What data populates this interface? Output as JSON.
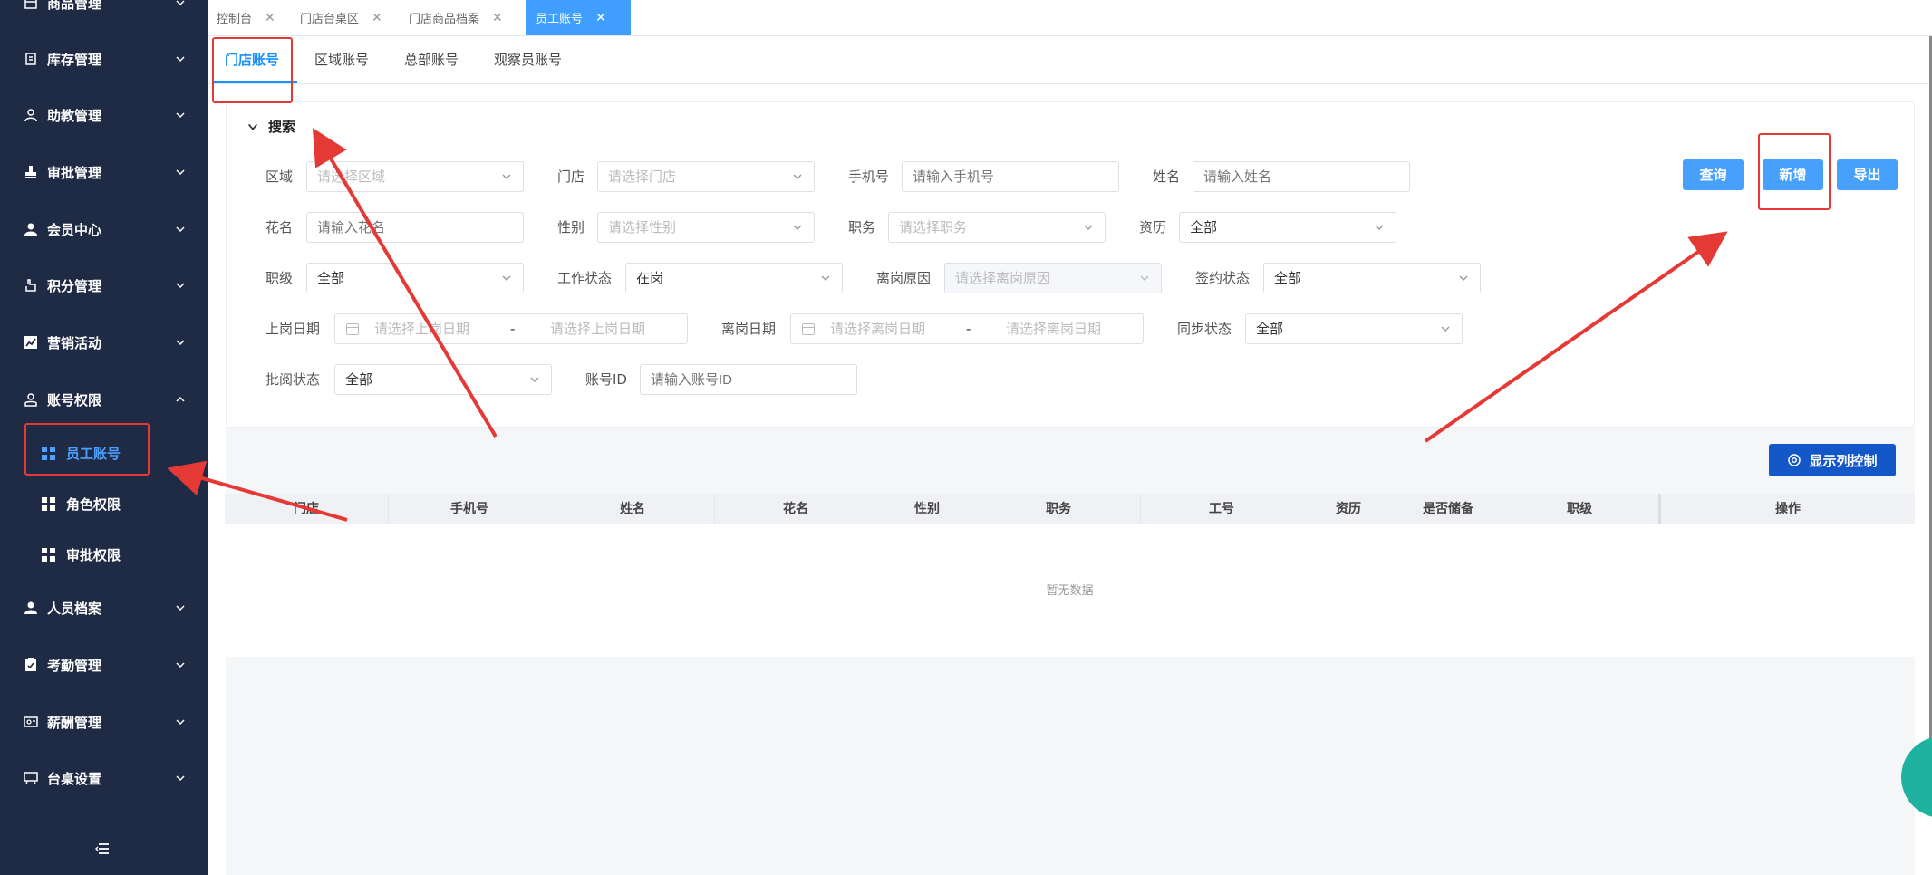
{
  "sidebar": {
    "items": [
      {
        "label": "商品管理",
        "icon": "goods-icon",
        "expanded": false
      },
      {
        "label": "库存管理",
        "icon": "inventory-icon",
        "expanded": false
      },
      {
        "label": "助教管理",
        "icon": "user-icon",
        "expanded": false
      },
      {
        "label": "审批管理",
        "icon": "stamp-icon",
        "expanded": false
      },
      {
        "label": "会员中心",
        "icon": "member-icon",
        "expanded": false
      },
      {
        "label": "积分管理",
        "icon": "points-icon",
        "expanded": false
      },
      {
        "label": "营销活动",
        "icon": "chart-icon",
        "expanded": false
      },
      {
        "label": "账号权限",
        "icon": "account-icon",
        "expanded": true
      },
      {
        "label": "人员档案",
        "icon": "person-icon",
        "expanded": false
      },
      {
        "label": "考勤管理",
        "icon": "clipboard-icon",
        "expanded": false
      },
      {
        "label": "薪酬管理",
        "icon": "salary-icon",
        "expanded": false
      },
      {
        "label": "台桌设置",
        "icon": "table-icon",
        "expanded": false
      }
    ],
    "subitems": [
      {
        "label": "员工账号",
        "active": true
      },
      {
        "label": "角色权限",
        "active": false
      },
      {
        "label": "审批权限",
        "active": false
      }
    ],
    "collapse_icon": "menu-collapse-icon"
  },
  "page_tabs": [
    {
      "label": "控制台",
      "active": false
    },
    {
      "label": "门店台桌区",
      "active": false
    },
    {
      "label": "门店商品档案",
      "active": false
    },
    {
      "label": "员工账号",
      "active": true
    }
  ],
  "sub_tabs": [
    {
      "label": "门店账号",
      "active": true
    },
    {
      "label": "区域账号",
      "active": false
    },
    {
      "label": "总部账号",
      "active": false
    },
    {
      "label": "观察员账号",
      "active": false
    }
  ],
  "search": {
    "title": "搜索",
    "fields": {
      "region": {
        "label": "区域",
        "placeholder": "请选择区域"
      },
      "store": {
        "label": "门店",
        "placeholder": "请选择门店"
      },
      "phone": {
        "label": "手机号",
        "placeholder": "请输入手机号"
      },
      "name": {
        "label": "姓名",
        "placeholder": "请输入姓名"
      },
      "nickname": {
        "label": "花名",
        "placeholder": "请输入花名"
      },
      "gender": {
        "label": "性别",
        "placeholder": "请选择性别"
      },
      "position": {
        "label": "职务",
        "placeholder": "请选择职务"
      },
      "seniority": {
        "label": "资历",
        "value": "全部"
      },
      "rank": {
        "label": "职级",
        "value": "全部"
      },
      "work_status": {
        "label": "工作状态",
        "value": "在岗"
      },
      "leave_reason": {
        "label": "离岗原因",
        "placeholder": "请选择离岗原因"
      },
      "contract_status": {
        "label": "签约状态",
        "value": "全部"
      },
      "onboard_date": {
        "label": "上岗日期",
        "start_placeholder": "请选择上岗日期",
        "end_placeholder": "请选择上岗日期",
        "separator": "-"
      },
      "leave_date": {
        "label": "离岗日期",
        "start_placeholder": "请选择离岗日期",
        "end_placeholder": "请选择离岗日期",
        "separator": "-"
      },
      "sync_status": {
        "label": "同步状态",
        "value": "全部"
      },
      "review_status": {
        "label": "批阅状态",
        "value": "全部"
      },
      "account_id": {
        "label": "账号ID",
        "placeholder": "请输入账号ID"
      }
    },
    "buttons": {
      "query": "查询",
      "add": "新增",
      "export": "导出"
    }
  },
  "table": {
    "column_control_label": "显示列控制",
    "columns": [
      "门店",
      "手机号",
      "姓名",
      "花名",
      "性别",
      "职务",
      "工号",
      "资历",
      "是否储备",
      "职级",
      "操作"
    ],
    "rows": [],
    "empty_text": "暂无数据"
  },
  "colors": {
    "sidebar_bg": "#1f2a44",
    "accent": "#409eff",
    "primary_button": "#46a0fc",
    "column_button": "#1457c9",
    "annotation_red": "#e53935"
  }
}
